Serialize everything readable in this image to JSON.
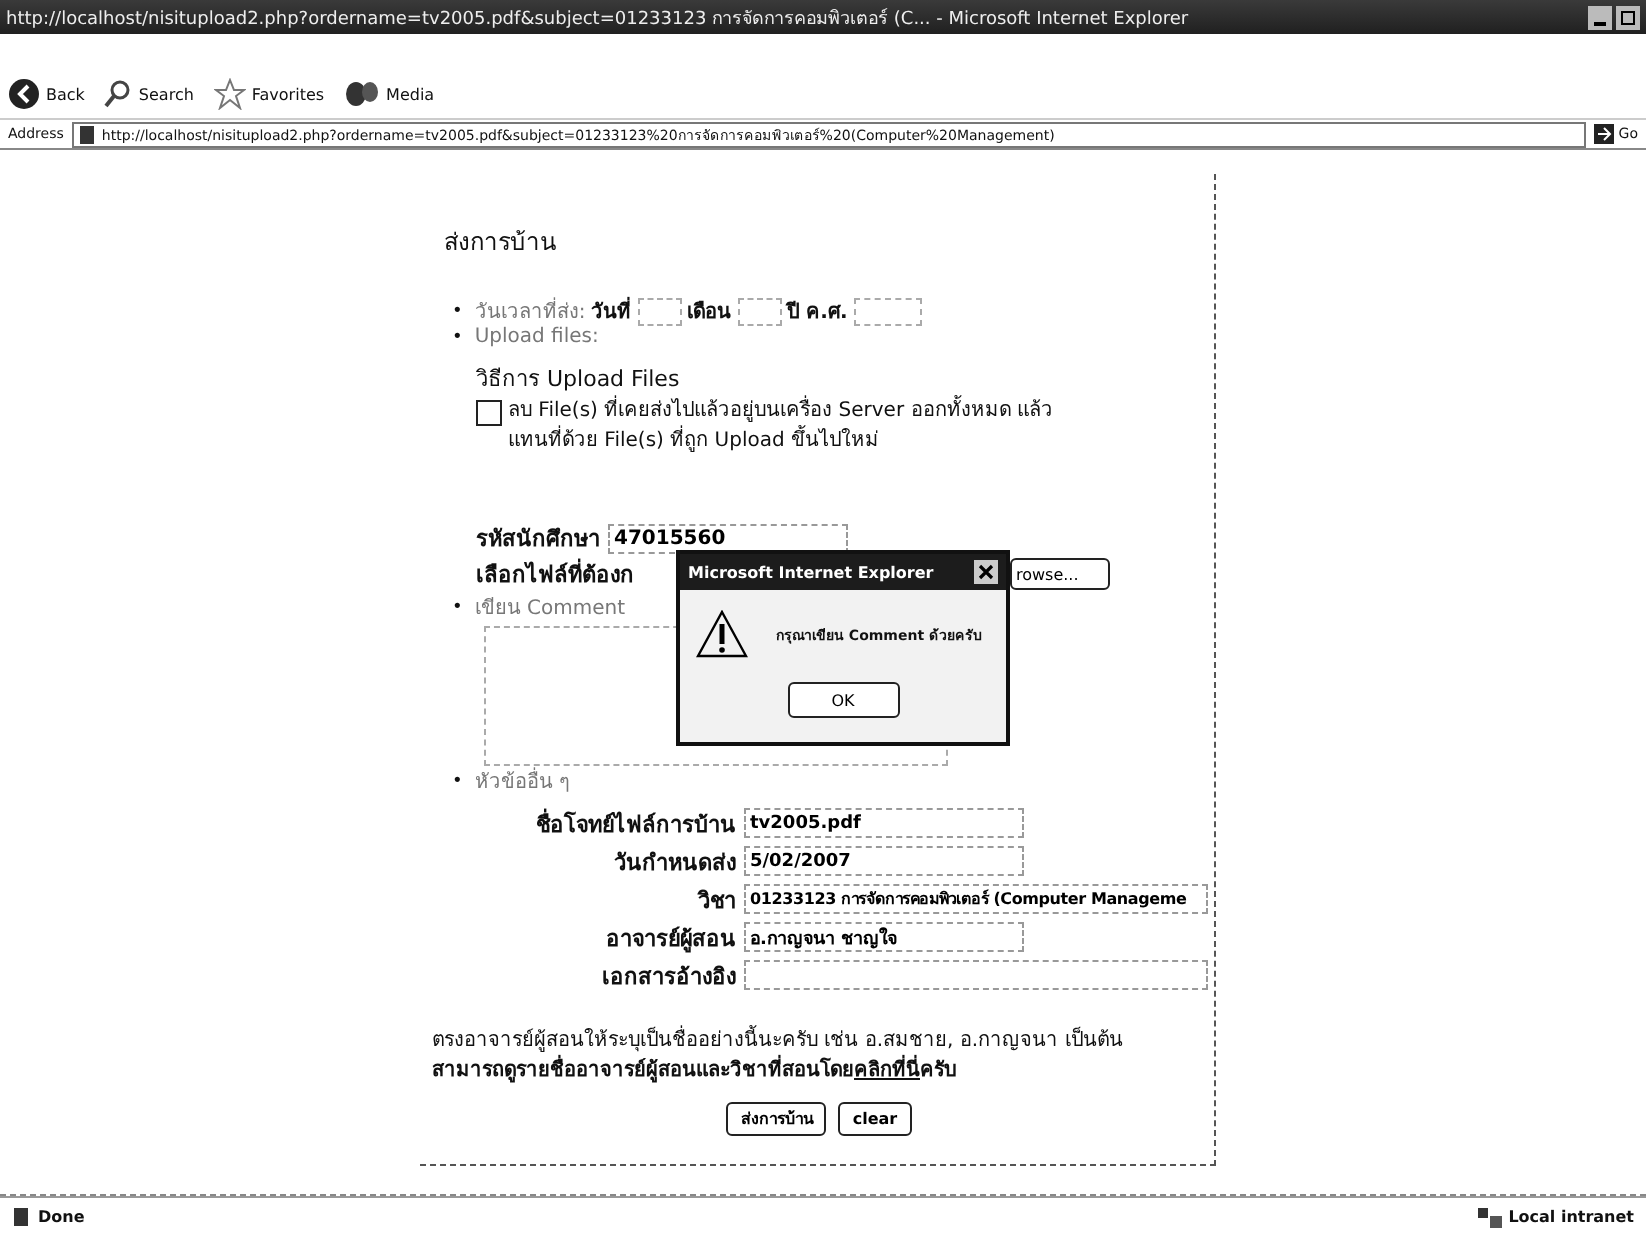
{
  "window": {
    "title": "http://localhost/nisitupload2.php?ordername=tv2005.pdf&subject=01233123 การจัดการคอมพิวเตอร์ (C... - Microsoft Internet Explorer"
  },
  "toolbar": {
    "buttons": [
      {
        "kind": "back",
        "label": "Back"
      },
      {
        "kind": "search",
        "label": "Search"
      },
      {
        "kind": "favorites",
        "label": "Favorites"
      },
      {
        "kind": "media",
        "label": "Media"
      }
    ]
  },
  "address_bar": {
    "label": "Address",
    "value": "http://localhost/nisitupload2.php?ordername=tv2005.pdf&subject=01233123%20การจัดการคอมพิวเตอร์%20(Computer%20Management)",
    "go": "Go"
  },
  "form": {
    "heading": "ส่งการบ้าน",
    "bullet": "•",
    "date_row": {
      "label": "วันเวลาที่ส่ง:",
      "day_label": "วันที่",
      "month_label": "เดือน",
      "year_label": "ปี ค.ศ."
    },
    "upload_label": "Upload files:",
    "method_title": "วิธีการ Upload Files",
    "replace_option": {
      "label": "ลบ File(s) ที่เคยส่งไปแล้วอยู่บนเครื่อง Server ออกทั้งหมด แล้วแทนที่ด้วย File(s) ที่ถูก Upload ขึ้นไปใหม่",
      "checked": false
    },
    "student_id": {
      "label": "รหัสนักศึกษา",
      "value": "47015560"
    },
    "file_label": "เลือกไฟล์ที่ต้องก",
    "browse_button": "rowse...",
    "comment_label": "เขียน Comment",
    "other_label": "หัวข้ออื่น ๆ",
    "fields": [
      {
        "label": "ชื่อโจทย์ไฟล์การบ้าน",
        "value": "tv2005.pdf",
        "wide": false
      },
      {
        "label": "วันกำหนดส่ง",
        "value": "5/02/2007",
        "wide": false
      },
      {
        "label": "วิชา",
        "value": "01233123 การจัดการคอมพิวเตอร์ (Computer Manageme",
        "wide": true
      },
      {
        "label": "อาจารย์ผู้สอน",
        "value": "อ.กาญจนา ชาญใจ",
        "wide": false
      },
      {
        "label": "เอกสารอ้างอิง",
        "wide": true
      }
    ],
    "note": "ตรงอาจารย์ผู้สอนให้ระบุเป็นชื่ออย่างนี้นะครับ เช่น อ.สมชาย, อ.กาญจนา เป็นต้น",
    "note_2": {
      "before": "สามารถดูรายชื่ออาจารย์ผู้สอนและวิชาที่สอนโดย",
      "link": "คลิกที่นี่",
      "after": "ครับ"
    },
    "buttons": [
      "ส่งการบ้าน",
      "clear"
    ]
  },
  "dialog": {
    "title": "Microsoft Internet Explorer",
    "message": "กรุณาเขียน Comment ด้วยครับ",
    "button": "OK"
  },
  "status_bar": {
    "text": "Done",
    "zone": "Local intranet"
  }
}
